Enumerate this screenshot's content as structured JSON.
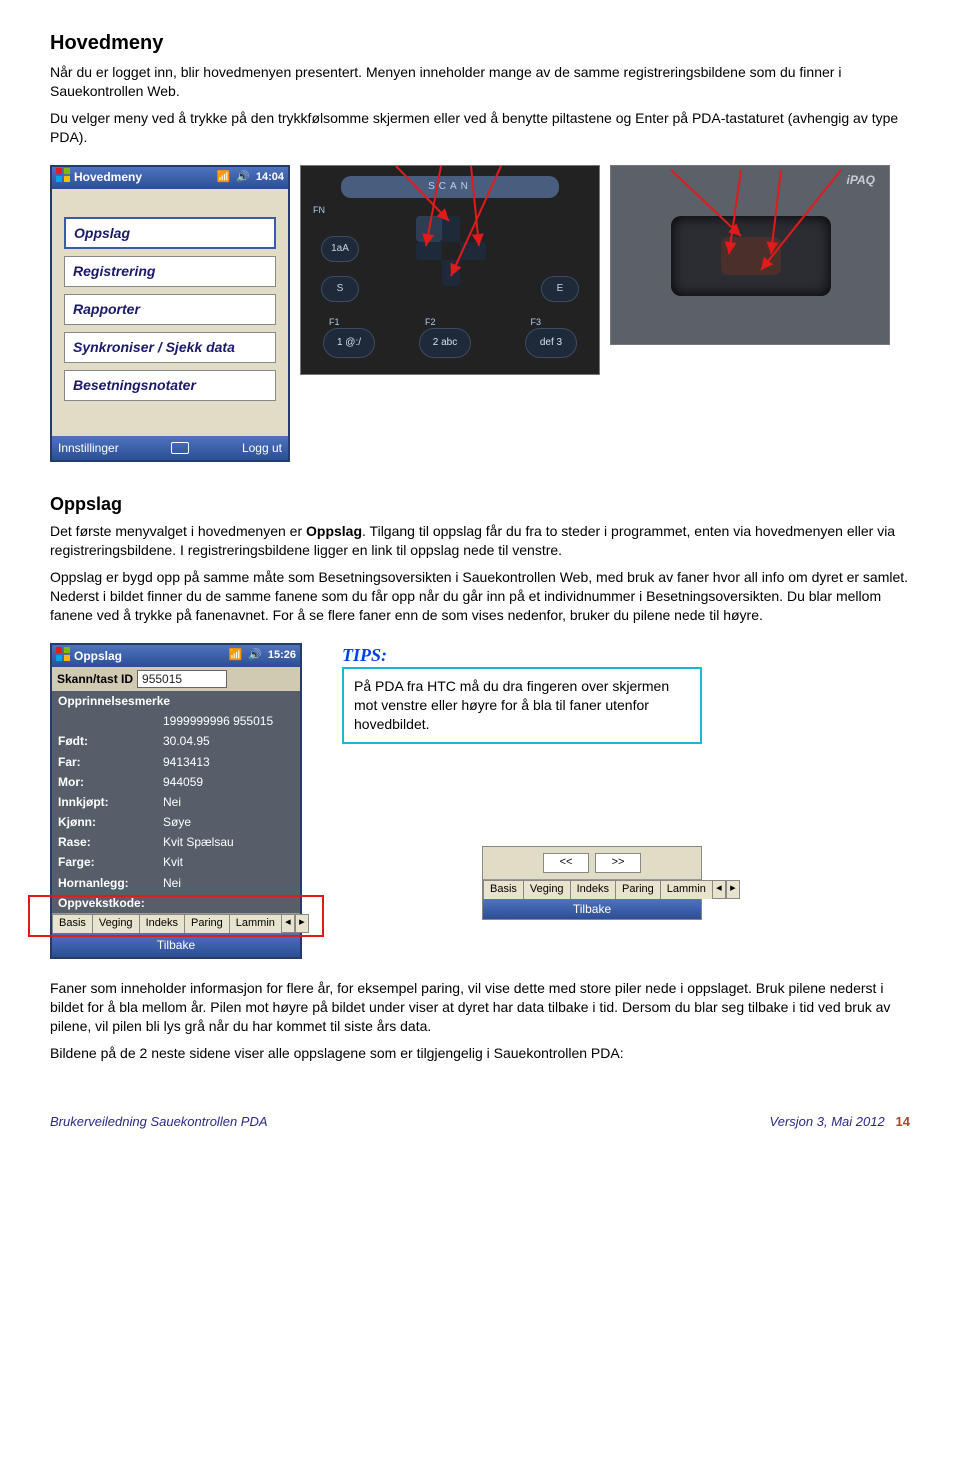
{
  "h1": "Hovedmeny",
  "intro1": "Når du er logget inn, blir hovedmenyen presentert. Menyen inneholder mange av de samme registreringsbildene som du finner i Sauekontrollen Web.",
  "intro2": "Du velger meny ved å trykke på den trykkfølsomme skjermen eller ved å benytte piltastene og Enter på PDA-tastaturet (avhengig av type PDA).",
  "hovedmeny_window": {
    "title": "Hovedmeny",
    "time": "14:04",
    "items": [
      "Oppslag",
      "Registrering",
      "Rapporter",
      "Synkroniser / Sjekk data",
      "Besetningsnotater"
    ],
    "footer_left": "Innstillinger",
    "footer_right": "Logg ut"
  },
  "keypad": {
    "scan": "SCAN",
    "fn": "FN",
    "keys": {
      "k1aA": "1aA",
      "s": "S",
      "e": "E",
      "k1": "1 @:/",
      "k2": "2 abc",
      "k3": "def 3",
      "f1": "F1",
      "f2": "F2",
      "f3": "F3"
    }
  },
  "ipaq_label": "iPAQ",
  "h2_oppslag": "Oppslag",
  "oppslag_p1a": "Det første menyvalget i hovedmenyen er ",
  "oppslag_p1b": "Oppslag",
  "oppslag_p1c": ". Tilgang til oppslag får du fra to steder i programmet, enten via hovedmenyen eller via registreringsbildene. I registreringsbildene ligger en link til oppslag nede til venstre.",
  "oppslag_p2": "Oppslag er bygd opp på samme måte som Besetningsoversikten i Sauekontrollen Web, med bruk av faner hvor all info om dyret er samlet. Nederst i bildet finner du de samme fanene som du får opp når du går inn på et individnummer i Besetningsoversikten. Du blar mellom fanene ved å trykke på fanenavnet. For å se flere faner enn de som vises nedenfor, bruker du pilene nede til høyre.",
  "oppslag_window": {
    "title": "Oppslag",
    "time": "15:26",
    "skann_label": "Skann/tast ID",
    "skann_value": "955015",
    "fields": [
      {
        "lbl": "Opprinnelsesmerke",
        "val": ""
      },
      {
        "lbl": "",
        "val": "1999999996    955015",
        "dark": true
      },
      {
        "lbl": "Født:",
        "val": "30.04.95",
        "dark": true
      },
      {
        "lbl": "Far:",
        "val": "9413413",
        "dark": true
      },
      {
        "lbl": "Mor:",
        "val": "944059",
        "dark": true
      },
      {
        "lbl": "Innkjøpt:",
        "val": "Nei",
        "dark": true
      },
      {
        "lbl": "Kjønn:",
        "val": "Søye",
        "dark": true
      },
      {
        "lbl": "Rase:",
        "val": "Kvit Spælsau",
        "dark": true
      },
      {
        "lbl": "Farge:",
        "val": "Kvit",
        "dark": true
      },
      {
        "lbl": "Hornanlegg:",
        "val": "Nei",
        "dark": true
      },
      {
        "lbl": "Oppvekstkode:",
        "val": "",
        "dark": true
      }
    ],
    "tabs": [
      "Basis",
      "Veging",
      "Indeks",
      "Paring",
      "Lammin"
    ],
    "footer": "Tilbake"
  },
  "tips_label": "TIPS:",
  "tips_text": "På PDA fra HTC må du dra fingeren over skjermen mot venstre eller høyre for å bla til faner utenfor hovedbildet.",
  "nav_mini": {
    "left": "<<",
    "right": ">>",
    "tabs": [
      "Basis",
      "Veging",
      "Indeks",
      "Paring",
      "Lammin"
    ],
    "footer": "Tilbake"
  },
  "para3": "Faner som inneholder informasjon for flere år, for eksempel paring, vil vise dette med store piler nede i oppslaget. Bruk pilene nederst i bildet for å bla mellom år. Pilen mot høyre på bildet under viser at dyret har data tilbake i tid. Dersom du blar seg tilbake i tid ved bruk av pilene, vil pilen bli lys grå når du har kommet til siste års data.",
  "para4": "Bildene på de 2 neste sidene viser alle oppslagene som er tilgjengelig i Sauekontrollen PDA:",
  "footer": {
    "left": "Brukerveiledning Sauekontrollen PDA",
    "right_text": "Versjon 3, Mai  2012",
    "page": "14"
  }
}
